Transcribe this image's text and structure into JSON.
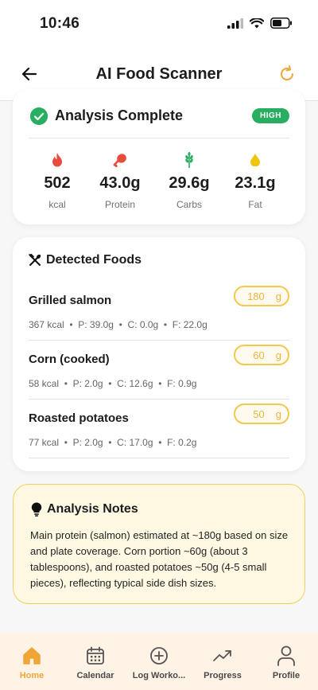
{
  "status_bar": {
    "time": "10:46"
  },
  "header": {
    "title": "AI Food Scanner"
  },
  "summary": {
    "title": "Analysis Complete",
    "confidence_badge": "HIGH",
    "macros": [
      {
        "value": "502",
        "label": "kcal",
        "icon": "flame-icon",
        "color": "#e74c3c"
      },
      {
        "value": "43.0g",
        "label": "Protein",
        "icon": "drumstick-icon",
        "color": "#e74c3c"
      },
      {
        "value": "29.6g",
        "label": "Carbs",
        "icon": "wheat-icon",
        "color": "#27ae60"
      },
      {
        "value": "23.1g",
        "label": "Fat",
        "icon": "drop-icon",
        "color": "#f1c40f"
      }
    ]
  },
  "foods": {
    "title": "Detected Foods",
    "items": [
      {
        "name": "Grilled salmon",
        "qty": "180",
        "unit": "g",
        "kcal": "367 kcal",
        "p": "P: 39.0g",
        "c": "C: 0.0g",
        "f": "F: 22.0g"
      },
      {
        "name": "Corn (cooked)",
        "qty": "60",
        "unit": "g",
        "kcal": "58 kcal",
        "p": "P: 2.0g",
        "c": "C: 12.6g",
        "f": "F: 0.9g"
      },
      {
        "name": "Roasted potatoes",
        "qty": "50",
        "unit": "g",
        "kcal": "77 kcal",
        "p": "P: 2.0g",
        "c": "C: 17.0g",
        "f": "F: 0.2g"
      }
    ]
  },
  "notes": {
    "title": "Analysis Notes",
    "text": "Main protein (salmon) estimated at ~180g based on size and plate coverage. Corn portion ~60g (about 3 tablespoons), and roasted potatoes ~50g (4-5 small pieces), reflecting typical side dish sizes."
  },
  "tabs": [
    {
      "label": "Home",
      "icon": "home-icon",
      "active": true
    },
    {
      "label": "Calendar",
      "icon": "calendar-icon",
      "active": false
    },
    {
      "label": "Log Worko...",
      "icon": "plus-circle-icon",
      "active": false
    },
    {
      "label": "Progress",
      "icon": "trending-up-icon",
      "active": false
    },
    {
      "label": "Profile",
      "icon": "person-icon",
      "active": false
    }
  ],
  "colors": {
    "accent": "#f0a637",
    "success": "#27ae60",
    "notes_bg": "#fff9e4",
    "notes_border": "#f2cf5b",
    "tabbar_bg": "#fff3e6"
  }
}
